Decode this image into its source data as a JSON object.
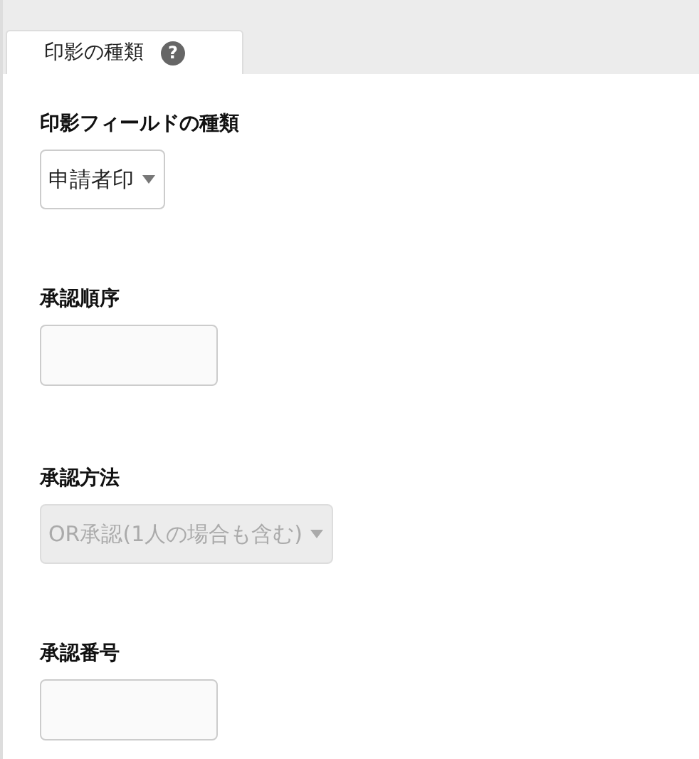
{
  "tabs": [
    {
      "label": "印影の種類",
      "selected": true,
      "help_icon": "?"
    }
  ],
  "fields": [
    {
      "kind": "select",
      "label": "印影フィールドの種類",
      "value": "申請者印",
      "disabled": false
    },
    {
      "kind": "input",
      "label": "承認順序",
      "disabled": false
    },
    {
      "kind": "select",
      "label": "承認方法",
      "value": "OR承認(1人の場合も含む)",
      "disabled": true
    },
    {
      "kind": "input",
      "label": "承認番号",
      "disabled": false
    }
  ]
}
